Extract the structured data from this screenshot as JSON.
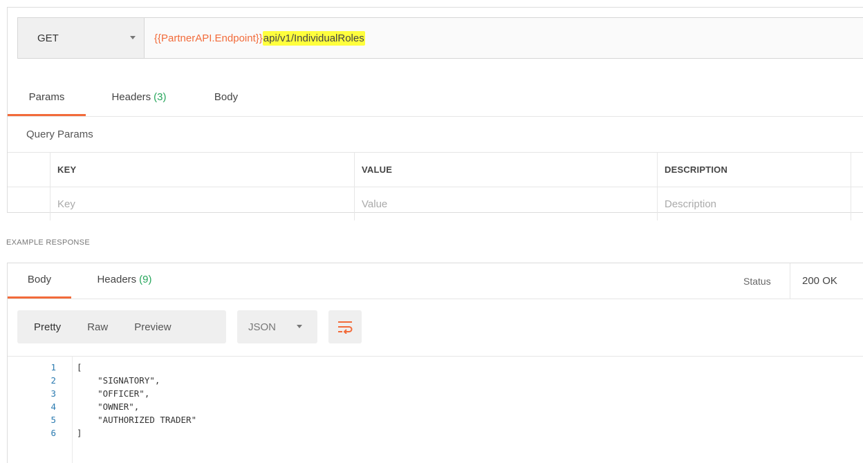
{
  "request": {
    "method": "GET",
    "url_variable": "{{PartnerAPI.Endpoint}}",
    "url_path": "api/v1/IndividualRoles",
    "tabs": [
      {
        "label": "Params",
        "count": ""
      },
      {
        "label": "Headers",
        "count": "(3)"
      },
      {
        "label": "Body",
        "count": ""
      }
    ],
    "query_params_title": "Query Params",
    "columns": {
      "key": "KEY",
      "value": "VALUE",
      "description": "DESCRIPTION"
    },
    "placeholders": {
      "key": "Key",
      "value": "Value",
      "description": "Description"
    }
  },
  "example_response": {
    "label": "EXAMPLE RESPONSE",
    "tabs": [
      {
        "label": "Body",
        "count": ""
      },
      {
        "label": "Headers",
        "count": "(9)"
      }
    ],
    "status_label": "Status",
    "status_value": "200 OK",
    "view_modes": [
      "Pretty",
      "Raw",
      "Preview"
    ],
    "format": "JSON",
    "code_lines": [
      {
        "n": "1",
        "text": "["
      },
      {
        "n": "2",
        "text": "    \"SIGNATORY\","
      },
      {
        "n": "3",
        "text": "    \"OFFICER\","
      },
      {
        "n": "4",
        "text": "    \"OWNER\","
      },
      {
        "n": "5",
        "text": "    \"AUTHORIZED TRADER\""
      },
      {
        "n": "6",
        "text": "]"
      }
    ]
  },
  "colors": {
    "accent": "#f26b3a",
    "count_green": "#26a65b",
    "highlight": "#ffff3d",
    "line_number": "#2a7ab0",
    "string": "#c0392b"
  }
}
